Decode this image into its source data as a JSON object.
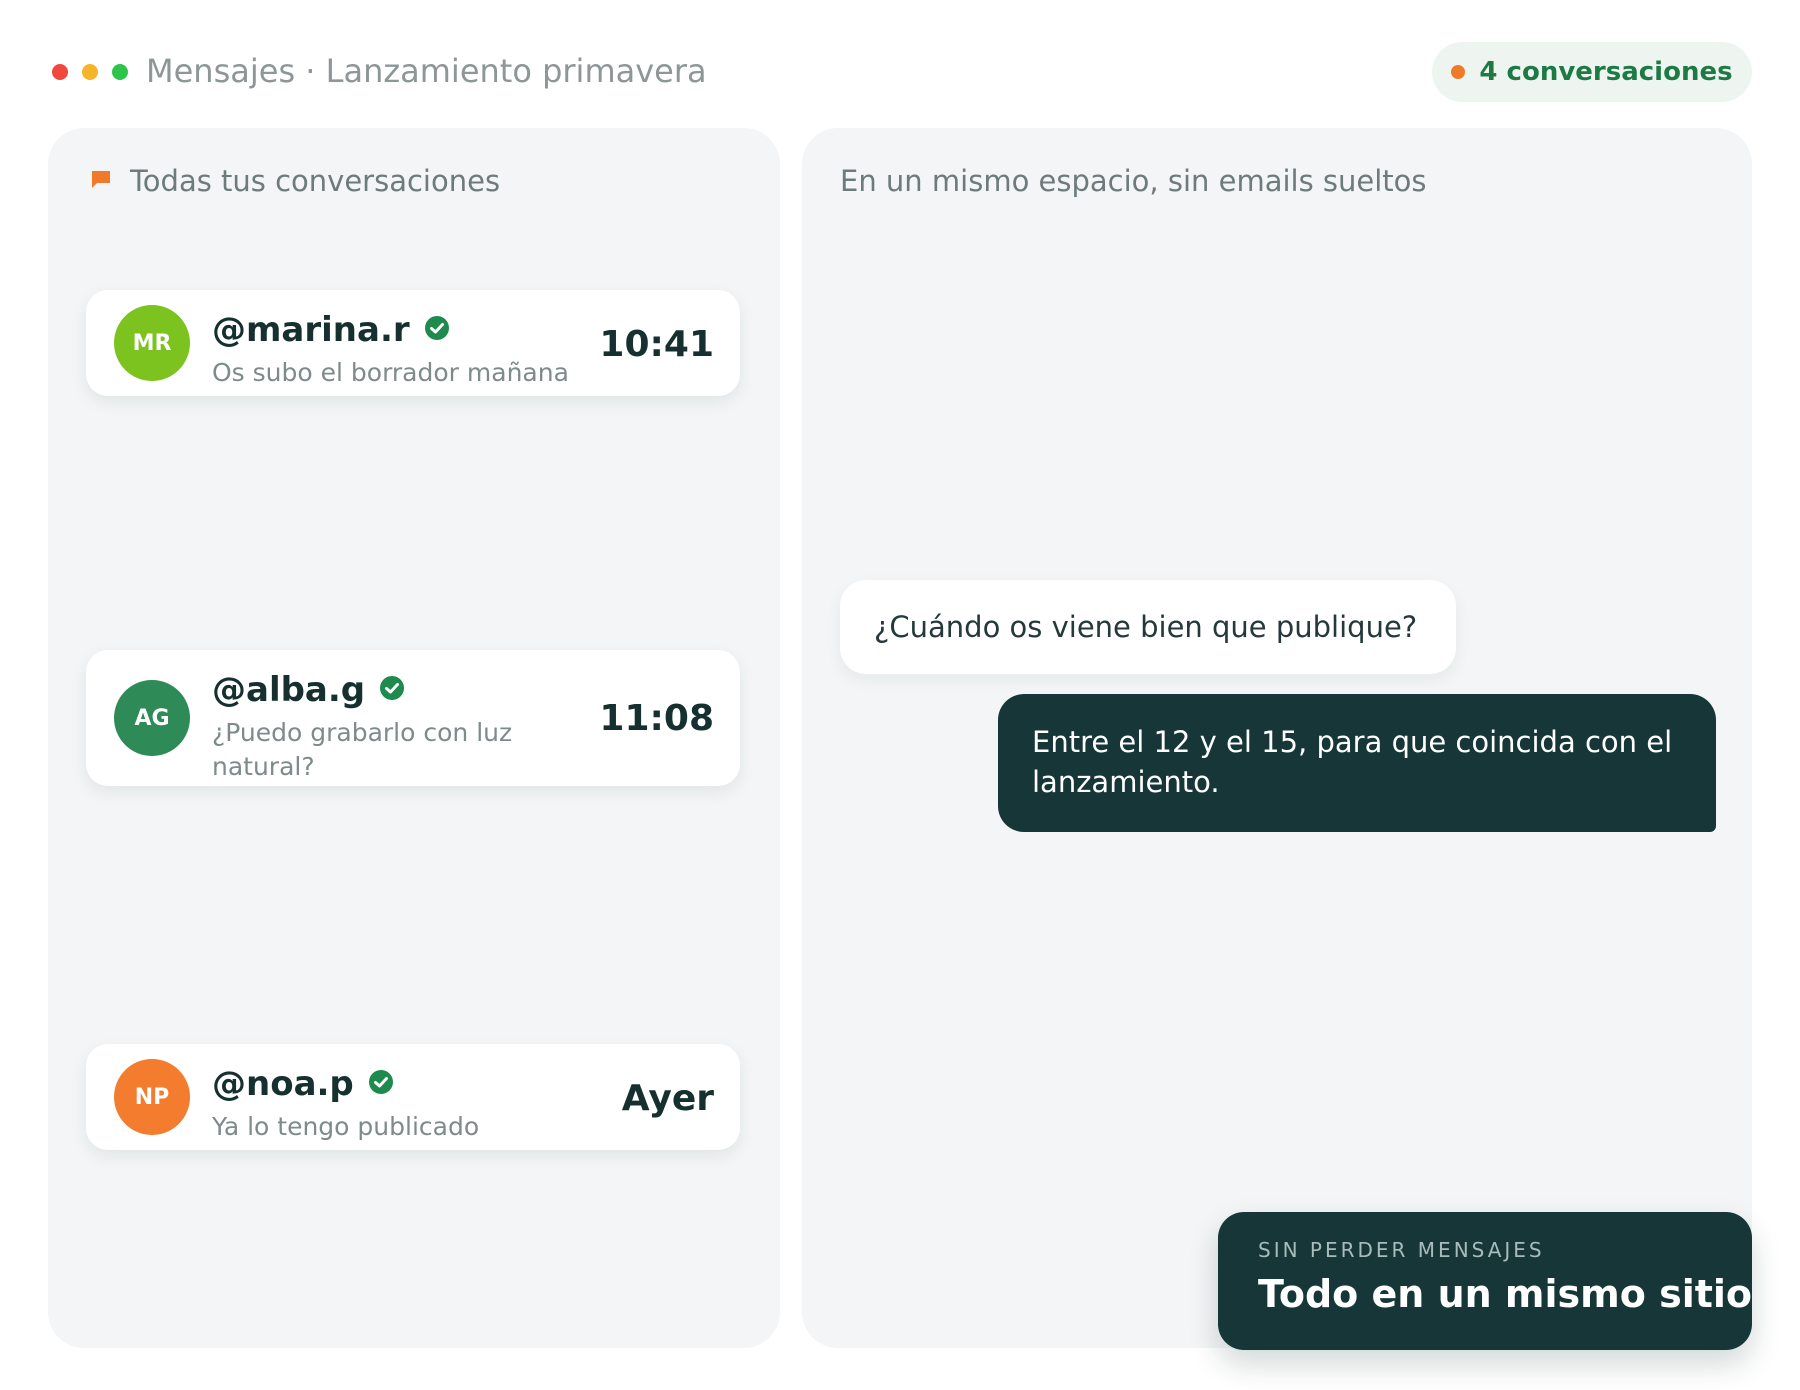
{
  "window": {
    "title": "Mensajes · Lanzamiento primavera",
    "traffic_lights": [
      "#f0473f",
      "#f5b52a",
      "#2dc44a"
    ],
    "conversation_count_label": "4 conversaciones",
    "conversation_count_dot_color": "#f07a2a"
  },
  "sidebar": {
    "heading": "Todas tus conversaciones",
    "heading_icon": "flag-icon",
    "conversations": [
      {
        "initials": "MR",
        "avatar_color": "#7cc31f",
        "handle": "@marina.r",
        "verified": true,
        "preview": "Os subo el borrador mañana",
        "time": "10:41"
      },
      {
        "initials": "AG",
        "avatar_color": "#2e8b57",
        "handle": "@alba.g",
        "verified": true,
        "preview": "¿Puedo grabarlo con luz natural?",
        "time": "11:08"
      },
      {
        "initials": "NP",
        "avatar_color": "#f47c2f",
        "handle": "@noa.p",
        "verified": true,
        "preview": "Ya lo tengo publicado",
        "time": "Ayer"
      }
    ]
  },
  "thread": {
    "heading": "En un mismo espacio, sin emails sueltos",
    "messages": [
      {
        "direction": "incoming",
        "text": "¿Cuándo os viene bien que publique?"
      },
      {
        "direction": "outgoing",
        "text": "Entre el 12 y el 15, para que coincida con el lanzamiento."
      }
    ]
  },
  "promo": {
    "eyebrow": "SIN PERDER MENSAJES",
    "title": "Todo en un mismo sitio"
  },
  "colors": {
    "dark_teal": "#163638",
    "accent_green": "#1e7a44",
    "accent_orange": "#f07a2a",
    "panel_bg": "#f3f5f6"
  }
}
